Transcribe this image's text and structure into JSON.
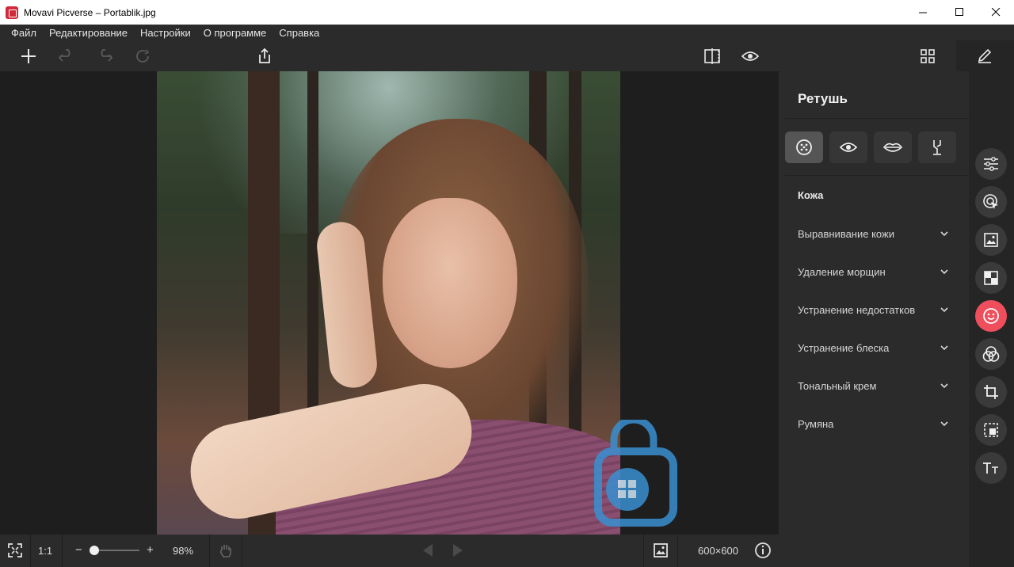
{
  "window": {
    "title": "Movavi Picverse – Portablik.jpg",
    "controls": [
      "minimize-icon",
      "maximize-icon",
      "close-icon"
    ]
  },
  "menu": [
    "Файл",
    "Редактирование",
    "Настройки",
    "О программе",
    "Справка"
  ],
  "toolbar": {
    "left_icons": [
      "add-icon",
      "undo-icon",
      "redo-icon",
      "reset-icon",
      "export-icon"
    ],
    "center_icons": [
      "compare-icon",
      "preview-eye-icon"
    ],
    "right_icons": [
      "grid-view-icon"
    ],
    "edit_icon": "pencil-icon"
  },
  "panel": {
    "title": "Ретушь",
    "tabs": [
      "skin-icon",
      "eye-icon",
      "lips-icon",
      "body-icon"
    ],
    "active_tab": "skin-icon",
    "section_title": "Кожа",
    "items": [
      "Выравнивание кожи",
      "Удаление морщин",
      "Устранение недостатков",
      "Устранение блеска",
      "Тональный крем",
      "Румяна"
    ]
  },
  "side_tools": [
    "adjust-sliders-icon",
    "ai-select-icon",
    "image-icon",
    "background-icon",
    "retouch-face-icon",
    "filters-icon",
    "crop-icon",
    "resize-icon",
    "text-icon"
  ],
  "active_side_tool": "retouch-face-icon",
  "bottom": {
    "fit_icon": "fit-screen-icon",
    "actual_size": "1:1",
    "zoom_minus": "−",
    "zoom_plus": "+",
    "zoom_value": "98%",
    "zoom_fraction": 0.1,
    "hand_icon": "hand-icon",
    "prev_icon": "prev-arrow-icon",
    "next_icon": "next-arrow-icon",
    "image_icon": "image-icon",
    "dimensions": "600×600",
    "info_icon": "info-icon"
  },
  "colors": {
    "accent": "#ef4f5d",
    "panel_bg": "#2b2b2b",
    "canvas_bg": "#1e1e1e"
  }
}
